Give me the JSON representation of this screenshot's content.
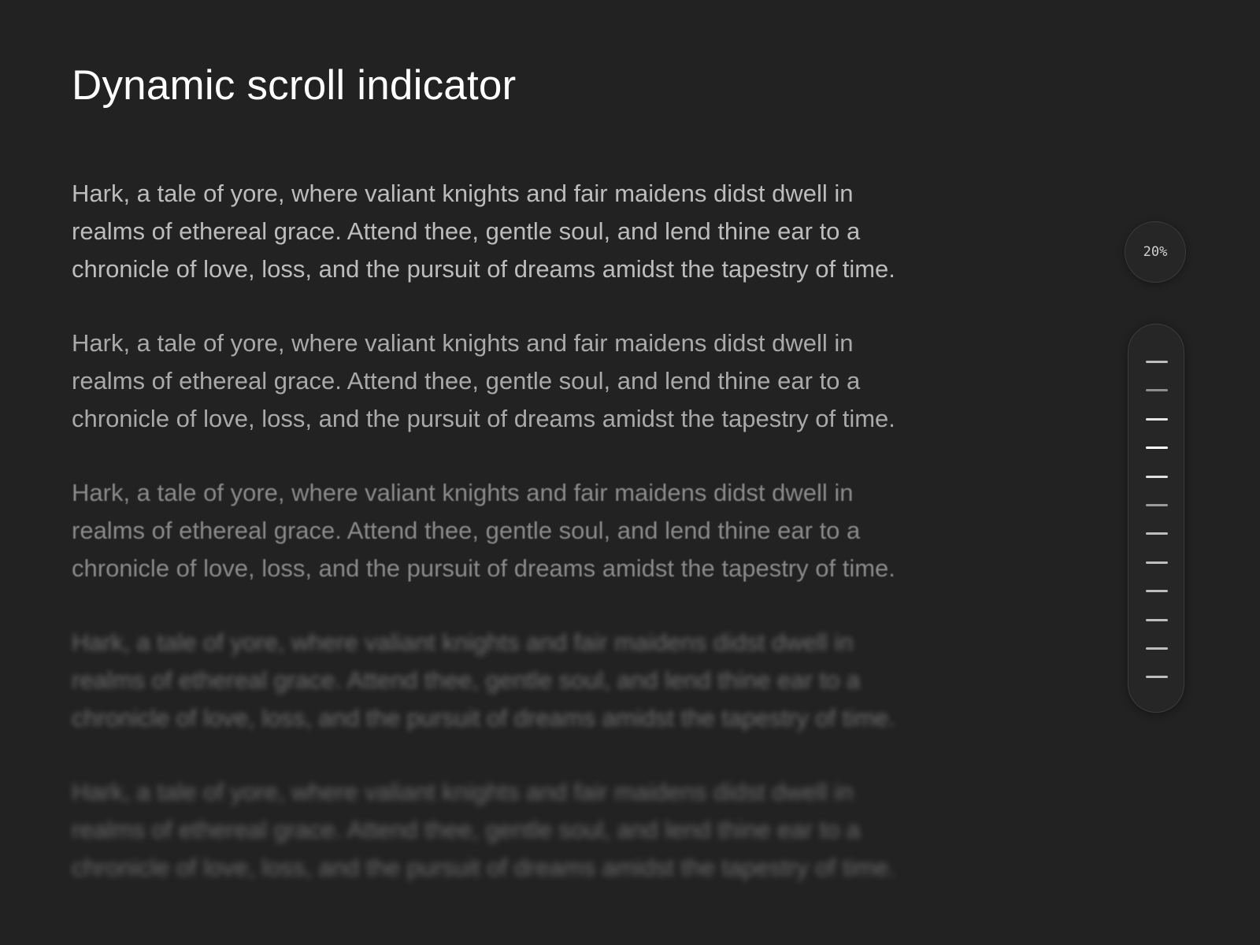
{
  "header": {
    "title": "Dynamic scroll indicator"
  },
  "content": {
    "paragraphs": [
      "Hark, a tale of yore, where valiant knights and fair maidens didst dwell in realms of ethereal grace. Attend thee, gentle soul, and lend thine ear to a chronicle of love, loss, and the pursuit of dreams amidst the tapestry of time.",
      "Hark, a tale of yore, where valiant knights and fair maidens didst dwell in realms of ethereal grace. Attend thee, gentle soul, and lend thine ear to a chronicle of love, loss, and the pursuit of dreams amidst the tapestry of time.",
      "Hark, a tale of yore, where valiant knights and fair maidens didst dwell in realms of ethereal grace. Attend thee, gentle soul, and lend thine ear to a chronicle of love, loss, and the pursuit of dreams amidst the tapestry of time.",
      "Hark, a tale of yore, where valiant knights and fair maidens didst dwell in realms of ethereal grace. Attend thee, gentle soul, and lend thine ear to a chronicle of love, loss, and the pursuit of dreams amidst the tapestry of time.",
      "Hark, a tale of yore, where valiant knights and fair maidens didst dwell in realms of ethereal grace. Attend thee, gentle soul, and lend thine ear to a chronicle of love, loss, and the pursuit of dreams amidst the tapestry of time."
    ]
  },
  "scroll_indicator": {
    "percent_label": "20%",
    "progress": 0.2,
    "tick_count": 12,
    "tick_colors": [
      "#bdbdbd",
      "#8e8e8e",
      "#e6e6e6",
      "#ffffff",
      "#e0e0e0",
      "#9a9a9a",
      "#bdbdbd",
      "#bdbdbd",
      "#bdbdbd",
      "#bdbdbd",
      "#bdbdbd",
      "#bdbdbd"
    ]
  },
  "colors": {
    "background": "#222223",
    "title": "#ffffff",
    "body_text": "#bdbdbd",
    "active_tick": "#ffffff"
  }
}
